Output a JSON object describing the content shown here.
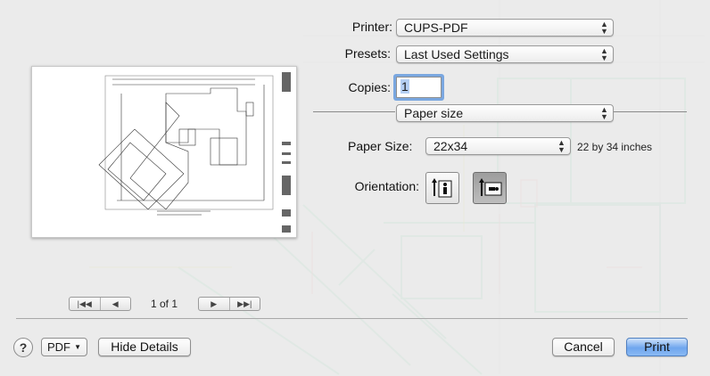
{
  "printer": {
    "label": "Printer:",
    "value": "CUPS-PDF"
  },
  "presets": {
    "label": "Presets:",
    "value": "Last Used Settings"
  },
  "copies": {
    "label": "Copies:",
    "value": "1"
  },
  "section": {
    "value": "Paper size"
  },
  "paper_size": {
    "label": "Paper Size:",
    "value": "22x34",
    "description": "22 by 34 inches"
  },
  "orientation": {
    "label": "Orientation:",
    "options": [
      "portrait",
      "landscape"
    ],
    "selected": "landscape"
  },
  "preview": {
    "page_count": "1 of 1"
  },
  "footer": {
    "help_label": "?",
    "pdf_label": "PDF",
    "hide_details_label": "Hide Details",
    "cancel_label": "Cancel",
    "print_label": "Print"
  },
  "icons": {
    "popup_arrows": "up-down-chevron-icon",
    "first_page": "first-page-icon",
    "prev_page": "previous-page-icon",
    "next_page": "next-page-icon",
    "last_page": "last-page-icon"
  },
  "colors": {
    "accent": "#6fa6ee",
    "field_focus": "#7aa7e0",
    "blueprint_line": "#7fc7a2"
  }
}
